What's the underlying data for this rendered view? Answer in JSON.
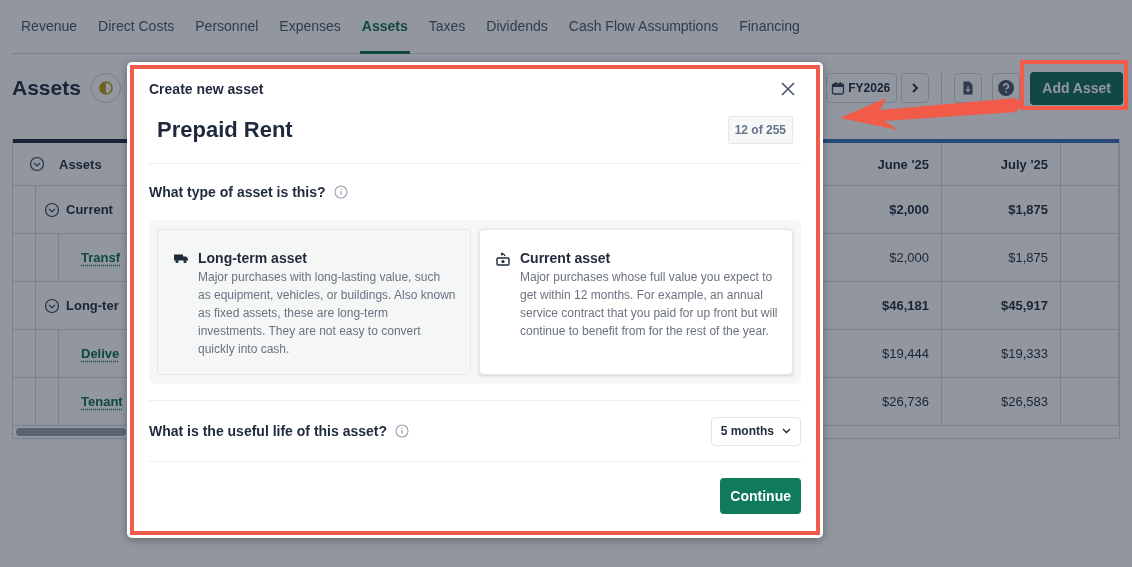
{
  "tabs": [
    {
      "label": "Revenue",
      "selected": false
    },
    {
      "label": "Direct Costs",
      "selected": false
    },
    {
      "label": "Personnel",
      "selected": false
    },
    {
      "label": "Expenses",
      "selected": false
    },
    {
      "label": "Assets",
      "selected": true
    },
    {
      "label": "Taxes",
      "selected": false
    },
    {
      "label": "Dividends",
      "selected": false
    },
    {
      "label": "Cash Flow Assumptions",
      "selected": false
    },
    {
      "label": "Financing",
      "selected": false
    }
  ],
  "page": {
    "title": "Assets",
    "period": "FY2026",
    "add_button": "Add Asset"
  },
  "table": {
    "expanded": true,
    "columns": [
      "Assets",
      "June '25",
      "July '25"
    ],
    "rows": [
      {
        "label": "Current",
        "kind": "group",
        "expanded": true,
        "values": [
          "$2,000",
          "$1,875"
        ],
        "children": [
          {
            "label": "Transf",
            "kind": "item",
            "values": [
              "$2,000",
              "$1,875"
            ]
          }
        ]
      },
      {
        "label": "Long-ter",
        "kind": "group",
        "expanded": true,
        "values": [
          "$46,181",
          "$45,917"
        ],
        "children": [
          {
            "label": "Delive",
            "kind": "item",
            "values": [
              "$19,444",
              "$19,333"
            ]
          },
          {
            "label": "Tenant",
            "kind": "item",
            "values": [
              "$26,736",
              "$26,583"
            ]
          }
        ]
      }
    ]
  },
  "dialog": {
    "title": "Create new asset",
    "asset_name": "Prepaid Rent",
    "counter": "12 of 255",
    "type_question": "What type of asset is this?",
    "options": [
      {
        "kind": "long_term",
        "title": "Long-term asset",
        "description": "Major purchases with long-lasting value, such as equipment, vehicles, or buildings. Also known as fixed assets, these are long-term investments. They are not easy to convert quickly into cash.",
        "selected": false
      },
      {
        "kind": "current",
        "title": "Current asset",
        "description": "Major purchases whose full value you expect to get within 12 months. For example, an annual service contract that you paid for up front but will continue to benefit from for the rest of the year.",
        "selected": true
      }
    ],
    "life_question": "What is the useful life of this asset?",
    "life_value": "5 months",
    "continue_button": "Continue"
  }
}
